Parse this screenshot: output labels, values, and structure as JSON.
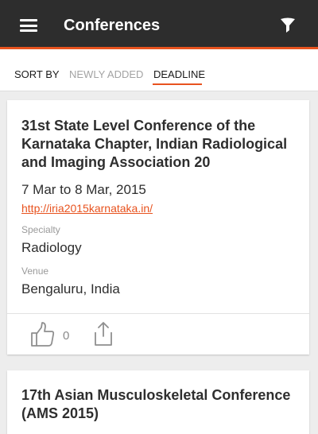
{
  "appbar": {
    "title": "Conferences",
    "menu_icon": "hamburger-menu-icon",
    "filter_icon": "filter-icon",
    "accent": "#e8531f"
  },
  "sort": {
    "label": "SORT BY",
    "options": [
      {
        "label": "NEWLY ADDED",
        "active": false
      },
      {
        "label": "DEADLINE",
        "active": true
      }
    ]
  },
  "cards": [
    {
      "title": "31st State Level Conference of the Karnataka Chapter, Indian Radiological and Imaging Association 20",
      "dates": "7 Mar to 8 Mar, 2015",
      "url": "http://iria2015karnataka.in/",
      "specialty_label": "Specialty",
      "specialty": "Radiology",
      "venue_label": "Venue",
      "venue": "Bengaluru, India",
      "likes": "0",
      "like_icon": "thumbs-up-icon",
      "share_icon": "share-icon"
    },
    {
      "title": "17th Asian Musculoskeletal Conference (AMS 2015)"
    }
  ]
}
